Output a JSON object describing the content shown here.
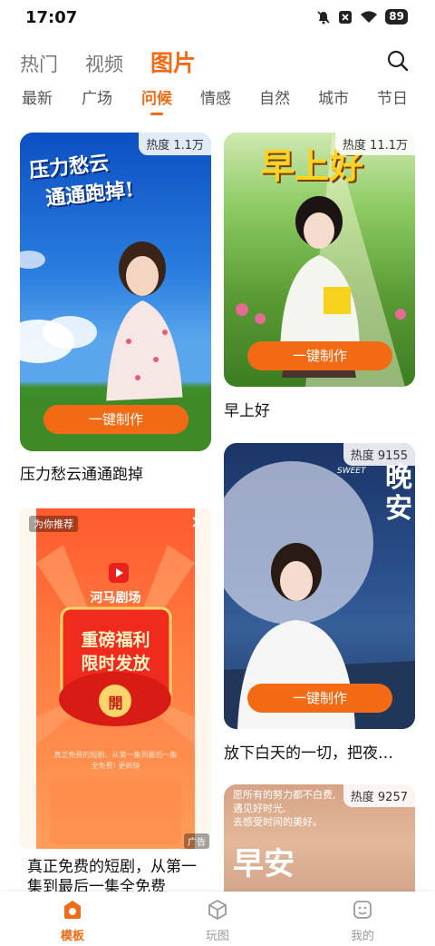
{
  "status_bar": {
    "time": "17:07",
    "battery": "89",
    "icons": [
      "mute-icon",
      "close-box-icon",
      "wifi-icon",
      "battery-icon"
    ]
  },
  "main_tabs": [
    {
      "label": "热门",
      "active": false
    },
    {
      "label": "视频",
      "active": false
    },
    {
      "label": "图片",
      "active": true
    }
  ],
  "sub_tabs": [
    {
      "label": "最新",
      "active": false
    },
    {
      "label": "广场",
      "active": false
    },
    {
      "label": "问候",
      "active": true
    },
    {
      "label": "情感",
      "active": false
    },
    {
      "label": "自然",
      "active": false
    },
    {
      "label": "城市",
      "active": false
    },
    {
      "label": "节日",
      "active": false
    }
  ],
  "cards": {
    "card1": {
      "heat": "热度 1.1万",
      "overlay": [
        "压力愁云",
        "通通跑掉!"
      ],
      "button": "一键制作",
      "caption": "压力愁云通通跑掉"
    },
    "card2": {
      "heat": "热度 11.1万",
      "overlay": "早上好",
      "button": "一键制作",
      "caption": "早上好"
    },
    "card3": {
      "heat": "热度 9155",
      "overlay_en": "SWEET",
      "overlay": "晚安",
      "button": "一键制作",
      "caption": "放下白天的一切，把夜…"
    },
    "card4": {
      "heat": "热度 9257",
      "overlay": "早安",
      "poem": [
        "愿所有的努力都不白费,",
        "遇见好时光,",
        "去感受时间的美好。"
      ]
    },
    "ad": {
      "tag": "为你推荐",
      "app_name": "河马剧场",
      "headline1": "重磅福利",
      "headline2": "限时发放",
      "open": "開",
      "small_text": [
        "真正免费的短剧、从第一集到最后一集",
        "全免费! 更新快"
      ],
      "ad_label": "广告",
      "caption": "真正免费的短剧，从第一集到最后一集全免费"
    }
  },
  "bottom_nav": [
    {
      "label": "模板",
      "icon": "template-icon",
      "active": true
    },
    {
      "label": "玩图",
      "icon": "cube-icon",
      "active": false
    },
    {
      "label": "我的",
      "icon": "profile-icon",
      "active": false
    }
  ],
  "colors": {
    "accent": "#f36a14",
    "text": "#111111",
    "muted": "#777777"
  }
}
